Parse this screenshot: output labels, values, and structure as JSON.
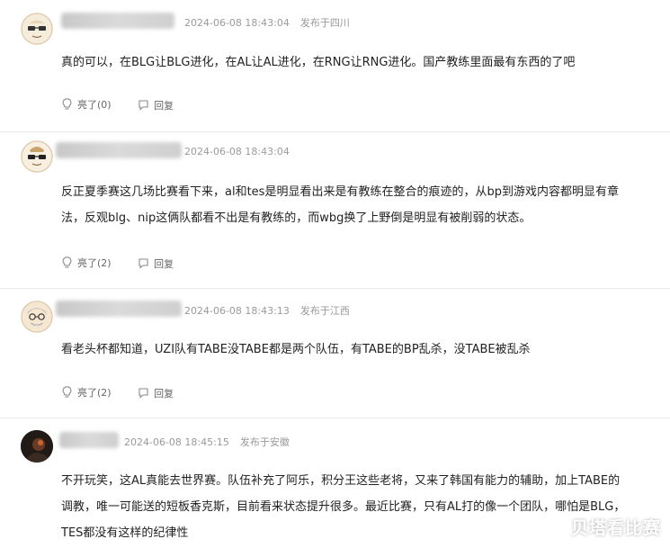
{
  "comments": [
    {
      "timestamp": "2024-06-08 18:43:04",
      "location": "发布于四川",
      "body_lines": [
        "真的可以，在BLG让BLG进化，在AL让AL进化，在RNG让RNG进化。国产教练里面最有东西的了吧"
      ],
      "like_label": "亮了(0)",
      "reply_label": "回复",
      "avatar_icon": "glasses-face-avatar"
    },
    {
      "timestamp": "2024-06-08 18:43:04",
      "location": "",
      "body_lines": [
        "反正夏季赛这几场比赛看下来，al和tes是明显看出来是有教练在整合的痕迹的，从bp到游戏内容都明显有章",
        "法，反观blg、nip这俩队都看不出是有教练的，而wbg换了上野倒是明显有被削弱的状态。"
      ],
      "like_label": "亮了(2)",
      "reply_label": "回复",
      "avatar_icon": "sunglasses-face-avatar"
    },
    {
      "timestamp": "2024-06-08 18:43:13",
      "location": "发布于江西",
      "body_lines": [
        "看老头杯都知道，UZI队有TABE没TABE都是两个队伍，有TABE的BP乱杀，没TABE被乱杀"
      ],
      "like_label": "亮了(2)",
      "reply_label": "回复",
      "avatar_icon": "old-man-face-avatar"
    },
    {
      "timestamp": "2024-06-08 18:45:15",
      "location": "发布于安徽",
      "body_lines": [
        "不开玩笑，这AL真能去世界赛。队伍补充了阿乐，积分王这些老将，又来了韩国有能力的辅助，加上TABE的",
        "调教，唯一可能送的短板香克斯，目前看来状态提升很多。最近比赛，只有AL打的像一个团队，哪怕是BLG，",
        "TES都没有这样的纪律性"
      ],
      "like_label": "",
      "reply_label": "",
      "avatar_icon": "dark-photo-avatar"
    }
  ],
  "watermark": "贝塔看比赛"
}
